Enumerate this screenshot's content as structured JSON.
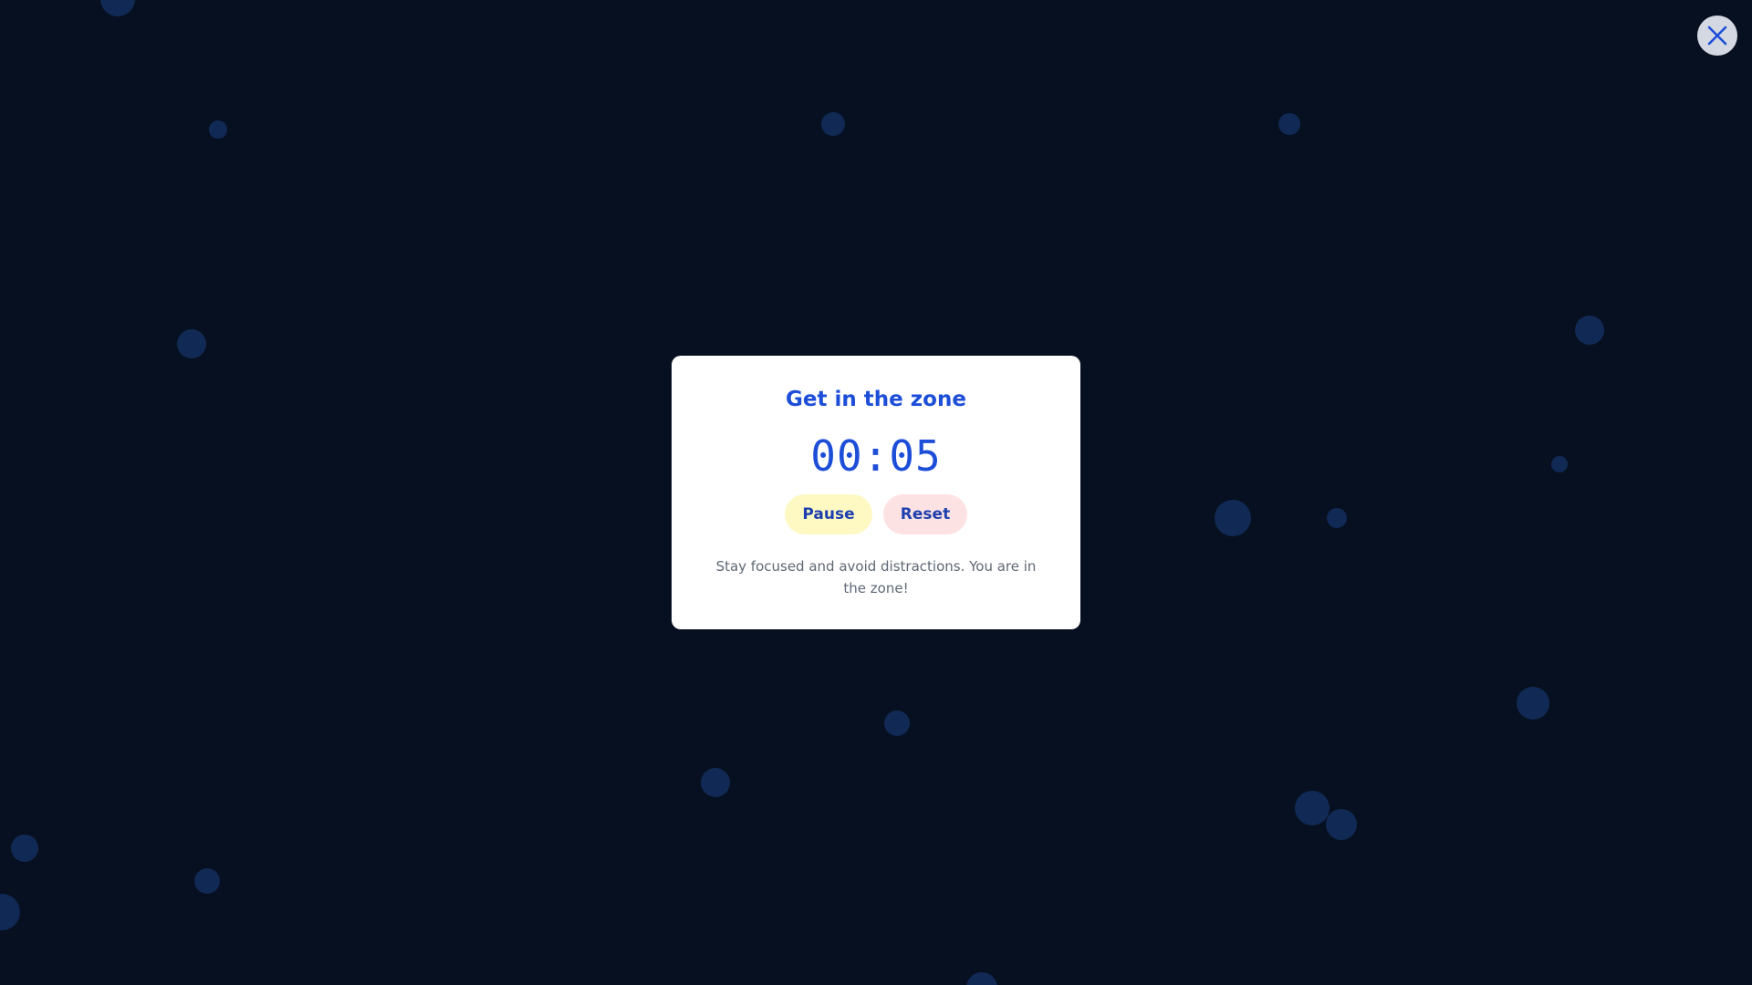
{
  "theme": {
    "background": "#071020",
    "bubble": "#112a55",
    "accent": "#1d4ed8",
    "pause_bg": "#fef9c3",
    "reset_bg": "#fde2e4"
  },
  "close": {
    "icon": "close-icon"
  },
  "modal": {
    "title": "Get in the zone",
    "timer": "00:05",
    "pause_label": "Pause",
    "reset_label": "Reset",
    "message": "Stay focused and avoid distractions. You are in the zone!"
  }
}
